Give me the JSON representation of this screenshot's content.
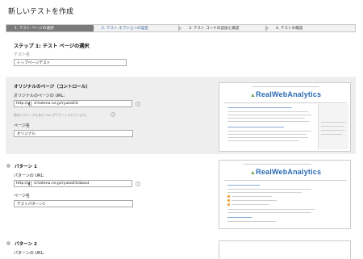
{
  "page": {
    "title": "新しいテストを作成"
  },
  "steps": [
    {
      "label": "1. テスト ページの選択"
    },
    {
      "label": "2. テスト オプションの設定"
    },
    {
      "label": "3. テスト コードの追加と確認"
    },
    {
      "label": "4. テストの確認"
    }
  ],
  "step1": {
    "heading": "ステップ 1: テスト ページの選択",
    "test_name_label": "テスト名",
    "test_name_value": "トップページテスト"
  },
  "original": {
    "heading": "オリジナルのページ（コントロール）",
    "url_label": "オリジナルのページの URL:",
    "protocol": "http://",
    "url_value": "d.hatena.ne.jp/ryuka01/",
    "note": "動的パラメータを含む URL がサポートされています。",
    "page_name_label": "ページ名",
    "page_name_value": "オリジナル",
    "thumb_site_title": "RealWebAnalytics"
  },
  "pattern1": {
    "heading": "パターン 1",
    "url_label": "パターンの URL:",
    "protocol": "http://",
    "url_value": "d.hatena.ne.jp/ryuka01/about",
    "page_name_label": "ページ名",
    "page_name_value": "テストパターン1",
    "thumb_site_title": "RealWebAnalytics"
  },
  "pattern2": {
    "heading": "パターン 2",
    "url_label": "パターンの URL:"
  },
  "icons": {
    "help": "?",
    "select_arrow": "▼"
  }
}
